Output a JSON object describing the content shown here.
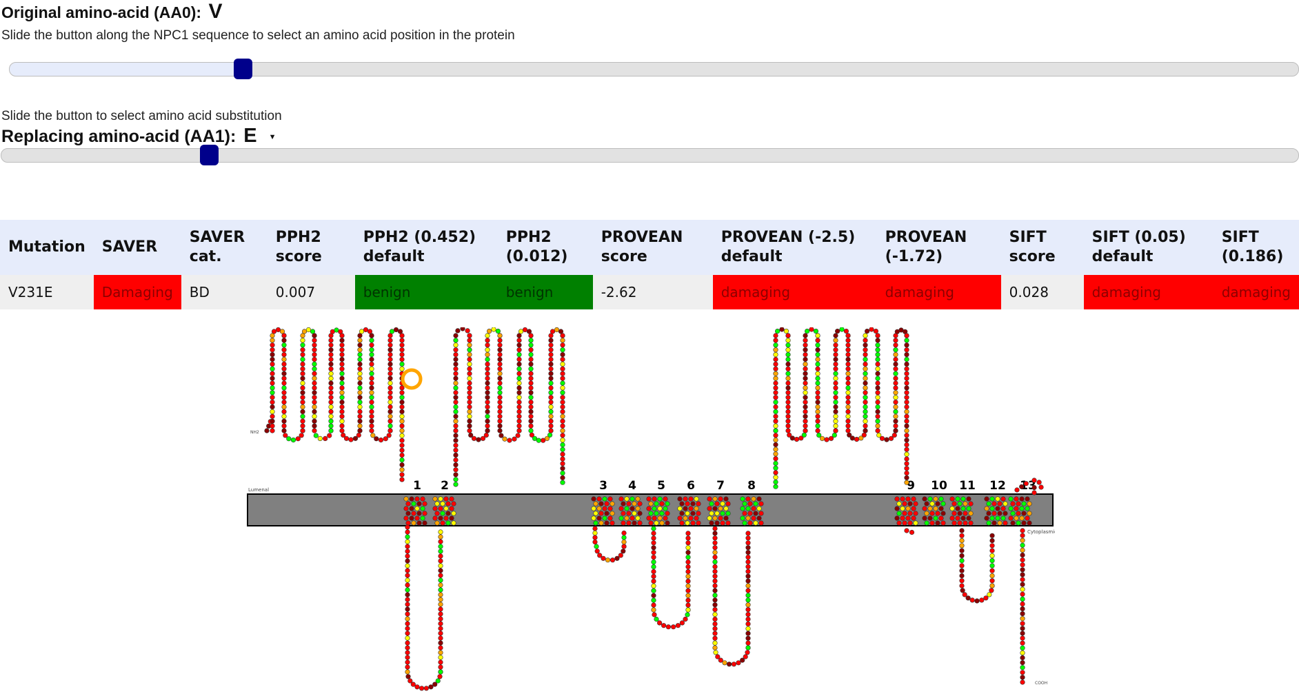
{
  "aa0": {
    "label": "Original amino-acid (AA0):",
    "value": "V"
  },
  "position_slider": {
    "instruction": "Slide the button along the NPC1 sequence to select an amino acid position in the protein",
    "value": 231,
    "max": 1278
  },
  "aa1": {
    "instruction": "Slide the button to select amino acid substitution",
    "label": "Replacing amino-acid (AA1):",
    "value": "E",
    "slider_fraction": 0.16
  },
  "results_table": {
    "headers": [
      "Mutation",
      "SAVER",
      "SAVER cat.",
      "PPH2 score",
      "PPH2 (0.452) default",
      "PPH2 (0.012)",
      "PROVEAN score",
      "PROVEAN (-2.5) default",
      "PROVEAN (-1.72)",
      "SIFT score",
      "SIFT (0.05) default",
      "SIFT (0.186)"
    ],
    "row": [
      "V231E",
      "Damaging",
      "BD",
      "0.007",
      "benign",
      "benign",
      "-2.62",
      "damaging",
      "damaging",
      "0.028",
      "damaging",
      "damaging"
    ],
    "cell_status": [
      "none",
      "red",
      "none",
      "none",
      "green",
      "green",
      "none",
      "red",
      "red",
      "none",
      "red",
      "red"
    ]
  },
  "topology": {
    "lumenal_label": "Lumenal",
    "cytoplasmic_label": "Cytoplasmic",
    "n_term_label": "NH2",
    "c_term_label": "COOH",
    "tm_labels": [
      "1",
      "2",
      "3",
      "4",
      "5",
      "6",
      "7",
      "8",
      "9",
      "10",
      "11",
      "12",
      "13"
    ],
    "membrane_color": "#808080",
    "residue_colors": [
      "#ff0000",
      "#00ff00",
      "#8b0000",
      "#ffff00",
      "#ffa500"
    ]
  }
}
